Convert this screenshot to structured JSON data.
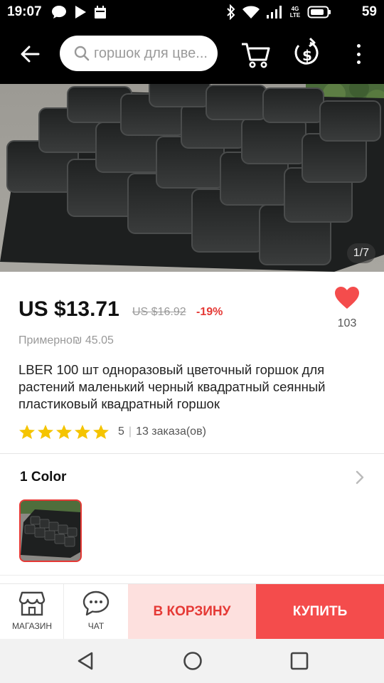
{
  "status_bar": {
    "time": "19:07",
    "network_label": "4G LTE",
    "battery_level": "59",
    "icons": [
      "chat-bubble-icon",
      "play-icon",
      "calendar-icon",
      "bluetooth-icon",
      "wifi-icon",
      "signal-icon",
      "battery-icon"
    ]
  },
  "toolbar": {
    "search_placeholder": "горшок для цве...",
    "icons": [
      "back-arrow-icon",
      "search-icon",
      "cart-icon",
      "currency-icon",
      "more-vert-icon"
    ]
  },
  "product": {
    "image_counter": "1/7",
    "price": "US $13.71",
    "old_price": "US $16.92",
    "discount": "-19%",
    "wishlist_count": "103",
    "approx_price": "Примерно₪ 45.05",
    "title": "LBER 100 шт одноразовый цветочный горшок для растений маленький черный квадратный сеянный пластиковый квадратный горшок",
    "rating": 5,
    "rating_text": "5",
    "rating_separator": "|",
    "orders": "13 заказа(ов)"
  },
  "variants": {
    "title": "1 Color",
    "selected_index": 0
  },
  "actions": {
    "shop_label": "МАГАЗИН",
    "chat_label": "ЧАТ",
    "add_to_cart_label": "В КОРЗИНУ",
    "buy_label": "КУПИТЬ"
  },
  "colors": {
    "accent": "#e53935",
    "buy_bg": "#f44c4c",
    "cart_bg": "#fde0de",
    "star": "#f5c400"
  }
}
